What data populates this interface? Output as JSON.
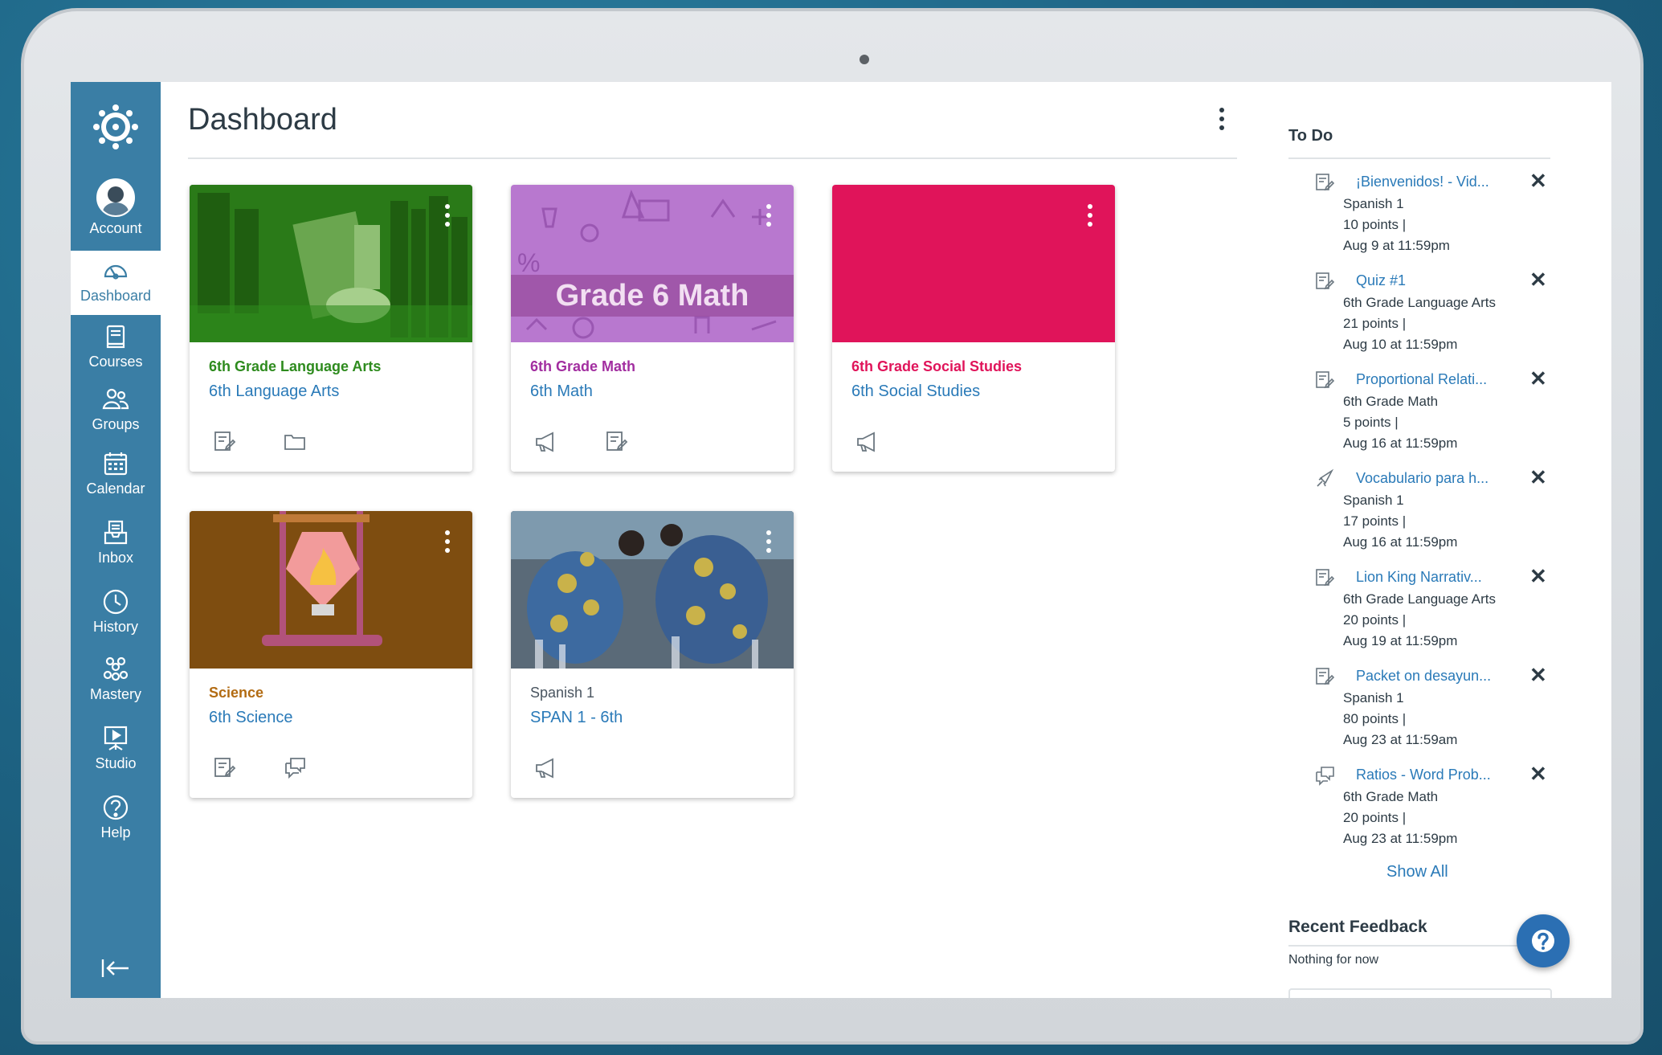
{
  "nav": {
    "items": [
      {
        "label": "Account",
        "icon": "avatar"
      },
      {
        "label": "Dashboard",
        "icon": "dashboard-icon",
        "active": true
      },
      {
        "label": "Courses",
        "icon": "courses-icon"
      },
      {
        "label": "Groups",
        "icon": "groups-icon"
      },
      {
        "label": "Calendar",
        "icon": "calendar-icon"
      },
      {
        "label": "Inbox",
        "icon": "inbox-icon"
      },
      {
        "label": "History",
        "icon": "history-icon"
      },
      {
        "label": "Mastery",
        "icon": "mastery-icon"
      },
      {
        "label": "Studio",
        "icon": "studio-icon"
      },
      {
        "label": "Help",
        "icon": "help-icon"
      }
    ],
    "colors": {
      "nav_bg": "#3a7ea5"
    }
  },
  "header": {
    "title": "Dashboard"
  },
  "cards": [
    {
      "title": "6th Grade Language Arts",
      "subtitle": "6th Language Arts",
      "color": "#2e8b1e",
      "hero_text": "",
      "icons": [
        "assignments-icon",
        "files-icon"
      ]
    },
    {
      "title": "6th Grade Math",
      "subtitle": "6th Math",
      "color": "#a22ea0",
      "hero_text": "Grade 6 Math",
      "icons": [
        "announcements-icon",
        "assignments-icon"
      ]
    },
    {
      "title": "6th Grade Social Studies",
      "subtitle": "6th Social Studies",
      "color": "#e0145a",
      "hero_text": "",
      "icons": [
        "announcements-icon"
      ]
    },
    {
      "title": "Science",
      "subtitle": "6th Science",
      "color": "#b26b12",
      "hero_text": "",
      "icons": [
        "assignments-icon",
        "discussions-icon"
      ]
    },
    {
      "title": "Spanish 1",
      "subtitle": "SPAN 1 - 6th",
      "color": "#4a5560",
      "hero_text": "",
      "icons": [
        "announcements-icon"
      ]
    }
  ],
  "todo": {
    "heading": "To Do",
    "items": [
      {
        "title": "¡Bienvenidos! - Vid...",
        "course": "Spanish 1",
        "points": "10 points  |",
        "due": "Aug 9 at 11:59pm",
        "icon": "assignment-icon"
      },
      {
        "title": "Quiz #1",
        "course": "6th Grade Language Arts",
        "points": "21 points  |",
        "due": "Aug 10 at 11:59pm",
        "icon": "assignment-icon"
      },
      {
        "title": "Proportional Relati...",
        "course": "6th Grade Math",
        "points": "5 points  |",
        "due": "Aug 16 at 11:59pm",
        "icon": "assignment-icon"
      },
      {
        "title": "Vocabulario para h...",
        "course": "Spanish 1",
        "points": "17 points  |",
        "due": "Aug 16 at 11:59pm",
        "icon": "quiz-rocket-icon"
      },
      {
        "title": "Lion King Narrativ...",
        "course": "6th Grade Language Arts",
        "points": "20 points  |",
        "due": "Aug 19 at 11:59pm",
        "icon": "assignment-icon"
      },
      {
        "title": "Packet on desayun...",
        "course": "Spanish 1",
        "points": "80 points  |",
        "due": "Aug 23 at 11:59am",
        "icon": "assignment-icon"
      },
      {
        "title": "Ratios - Word Prob...",
        "course": "6th Grade Math",
        "points": "20 points  |",
        "due": "Aug 23 at 11:59pm",
        "icon": "discussion-icon"
      }
    ],
    "dismiss_glyph": "✕",
    "show_all": "Show All"
  },
  "recent_feedback": {
    "heading": "Recent Feedback",
    "empty": "Nothing for now"
  },
  "help_fab": {
    "glyph": "?"
  }
}
